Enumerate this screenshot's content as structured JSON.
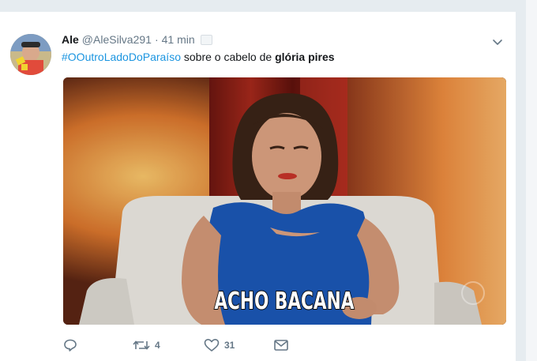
{
  "tweet": {
    "display_name": "Ale",
    "handle": "@AleSilva291",
    "separator": "·",
    "timestamp": "41 min",
    "text": {
      "hashtag": "#OOutroLadoDoParaíso",
      "middle": " sobre o cabelo de ",
      "bold": "glória pires"
    },
    "media": {
      "caption": "ACHO BACANA"
    },
    "actions": {
      "reply_icon": "reply-icon",
      "retweet_icon": "retweet-icon",
      "retweet_count": "4",
      "like_icon": "heart-icon",
      "like_count": "31",
      "dm_icon": "envelope-icon"
    }
  },
  "colors": {
    "hashtag": "#1b95e0",
    "text": "#14171a",
    "secondary": "#657786",
    "divider": "#e6ecf0"
  }
}
